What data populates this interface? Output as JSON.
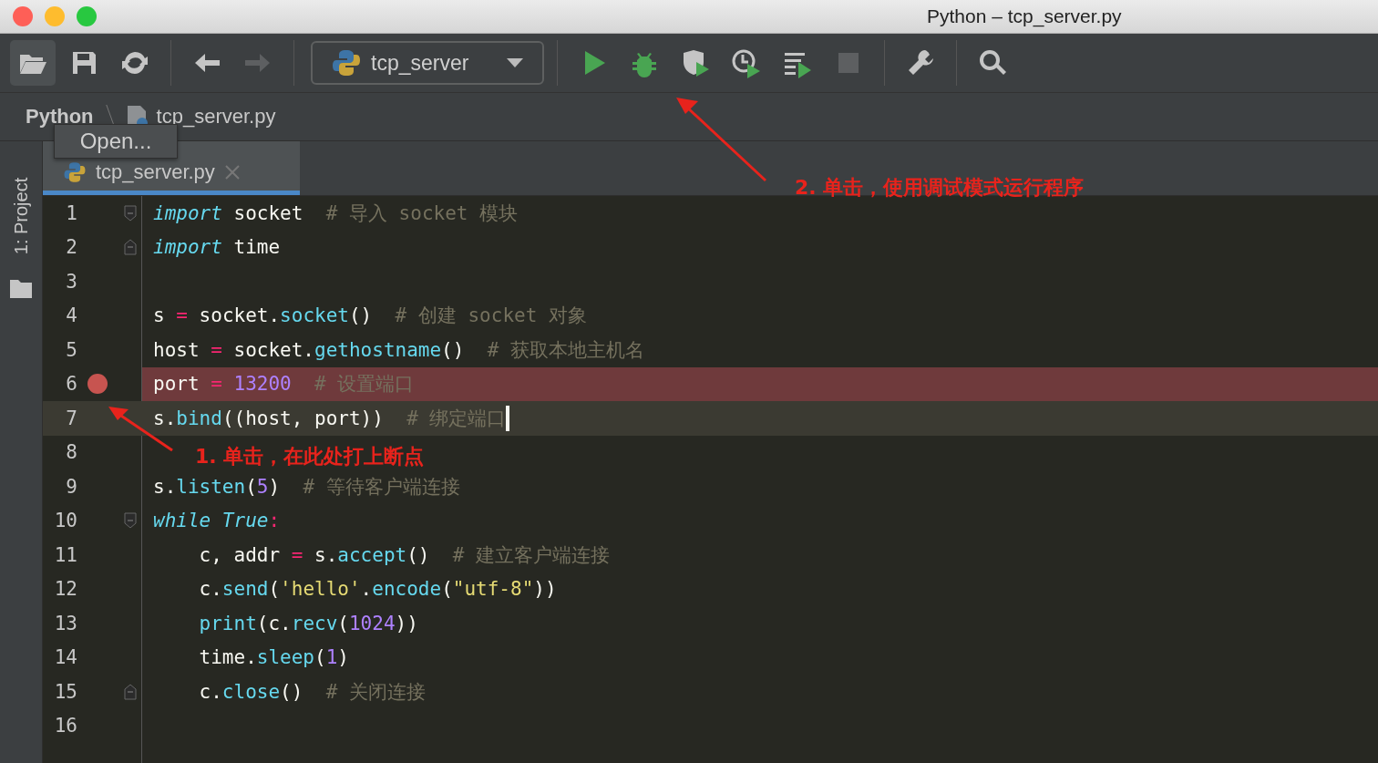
{
  "window": {
    "title": "Python – tcp_server.py"
  },
  "toolbar": {
    "buttons": [
      {
        "selected": true,
        "disabled": false
      },
      {
        "selected": false,
        "disabled": false
      },
      {
        "selected": false,
        "disabled": false
      },
      {
        "selected": false,
        "disabled": false
      },
      {
        "selected": false,
        "disabled": true
      },
      {
        "selected": false,
        "disabled": false
      },
      {
        "selected": false,
        "disabled": false
      },
      {
        "selected": false,
        "disabled": false
      },
      {
        "selected": false,
        "disabled": false
      },
      {
        "selected": false,
        "disabled": false
      },
      {
        "selected": false,
        "disabled": true
      },
      {
        "selected": false,
        "disabled": false
      },
      {
        "selected": false,
        "disabled": false
      }
    ],
    "run_config": {
      "label": "tcp_server"
    }
  },
  "breadcrumb": [
    {
      "label": "Python"
    },
    {
      "label": "tcp_server.py"
    }
  ],
  "tooltip": {
    "text": "Open..."
  },
  "side_panel": {
    "label": "1: Project"
  },
  "tabs": [
    {
      "label": "tcp_server.py",
      "selected": true
    }
  ],
  "editor": {
    "lines": [
      {
        "number": "1",
        "kind": "fold_start",
        "breakpoint": false,
        "current": false,
        "tokens": [
          {
            "kind": "kw",
            "text": "import"
          },
          {
            "kind": "plain",
            "text": " socket"
          },
          {
            "kind": "cmt",
            "text": "  # 导入 socket 模块"
          }
        ]
      },
      {
        "number": "2",
        "kind": "fold_end",
        "breakpoint": false,
        "current": false,
        "tokens": [
          {
            "kind": "kw",
            "text": "import"
          },
          {
            "kind": "plain",
            "text": " time"
          }
        ]
      },
      {
        "number": "3",
        "kind": "plain",
        "breakpoint": false,
        "current": false
      },
      {
        "number": "4",
        "kind": "plain",
        "breakpoint": false,
        "current": false,
        "tokens": [
          {
            "kind": "plain",
            "text": "s"
          },
          {
            "kind": "op",
            "text": " = "
          },
          {
            "kind": "plain",
            "text": "socket."
          },
          {
            "kind": "fn",
            "text": "socket"
          },
          {
            "kind": "plain",
            "text": "()"
          },
          {
            "kind": "cmt",
            "text": "  # 创建 socket 对象"
          }
        ]
      },
      {
        "number": "5",
        "kind": "plain",
        "breakpoint": false,
        "current": false,
        "tokens": [
          {
            "kind": "plain",
            "text": "host"
          },
          {
            "kind": "op",
            "text": " = "
          },
          {
            "kind": "plain",
            "text": "socket."
          },
          {
            "kind": "fn",
            "text": "gethostname"
          },
          {
            "kind": "plain",
            "text": "()"
          },
          {
            "kind": "cmt",
            "text": "  # 获取本地主机名"
          }
        ]
      },
      {
        "number": "6",
        "kind": "plain",
        "breakpoint": true,
        "current": false,
        "tokens": [
          {
            "kind": "plain",
            "text": "port"
          },
          {
            "kind": "op",
            "text": " = "
          },
          {
            "kind": "num",
            "text": "13200"
          },
          {
            "kind": "cmt",
            "text": "  # 设置端口"
          }
        ]
      },
      {
        "number": "7",
        "kind": "plain",
        "breakpoint": false,
        "current": true,
        "tokens": [
          {
            "kind": "plain",
            "text": "s."
          },
          {
            "kind": "fn",
            "text": "bind"
          },
          {
            "kind": "plain",
            "text": "((host, port))"
          },
          {
            "kind": "cmt",
            "text": "  # 绑定端口"
          }
        ]
      },
      {
        "number": "8",
        "kind": "plain",
        "breakpoint": false,
        "current": false
      },
      {
        "number": "9",
        "kind": "plain",
        "breakpoint": false,
        "current": false,
        "tokens": [
          {
            "kind": "plain",
            "text": "s."
          },
          {
            "kind": "fn",
            "text": "listen"
          },
          {
            "kind": "plain",
            "text": "("
          },
          {
            "kind": "num",
            "text": "5"
          },
          {
            "kind": "plain",
            "text": ")"
          },
          {
            "kind": "cmt",
            "text": "  # 等待客户端连接"
          }
        ]
      },
      {
        "number": "10",
        "kind": "fold_start",
        "breakpoint": false,
        "current": false,
        "tokens": [
          {
            "kind": "kw",
            "text": "while"
          },
          {
            "kind": "kw",
            "text": " True"
          },
          {
            "kind": "op",
            "text": ":"
          }
        ]
      },
      {
        "number": "11",
        "kind": "plain",
        "breakpoint": false,
        "current": false,
        "tokens": [
          {
            "kind": "plain",
            "text": "    c, addr"
          },
          {
            "kind": "op",
            "text": " = "
          },
          {
            "kind": "plain",
            "text": "s."
          },
          {
            "kind": "fn",
            "text": "accept"
          },
          {
            "kind": "plain",
            "text": "()"
          },
          {
            "kind": "cmt",
            "text": "  # 建立客户端连接"
          }
        ]
      },
      {
        "number": "12",
        "kind": "plain",
        "breakpoint": false,
        "current": false,
        "tokens": [
          {
            "kind": "plain",
            "text": "    c."
          },
          {
            "kind": "fn",
            "text": "send"
          },
          {
            "kind": "plain",
            "text": "("
          },
          {
            "kind": "str",
            "text": "'hello'"
          },
          {
            "kind": "plain",
            "text": "."
          },
          {
            "kind": "fn",
            "text": "encode"
          },
          {
            "kind": "plain",
            "text": "("
          },
          {
            "kind": "str",
            "text": "\"utf-8\""
          },
          {
            "kind": "plain",
            "text": "))"
          }
        ]
      },
      {
        "number": "13",
        "kind": "plain",
        "breakpoint": false,
        "current": false,
        "tokens": [
          {
            "kind": "fn",
            "text": "    print"
          },
          {
            "kind": "plain",
            "text": "(c."
          },
          {
            "kind": "fn",
            "text": "recv"
          },
          {
            "kind": "plain",
            "text": "("
          },
          {
            "kind": "num",
            "text": "1024"
          },
          {
            "kind": "plain",
            "text": "))"
          }
        ]
      },
      {
        "number": "14",
        "kind": "plain",
        "breakpoint": false,
        "current": false,
        "tokens": [
          {
            "kind": "plain",
            "text": "    time."
          },
          {
            "kind": "fn",
            "text": "sleep"
          },
          {
            "kind": "plain",
            "text": "("
          },
          {
            "kind": "num",
            "text": "1"
          },
          {
            "kind": "plain",
            "text": ")"
          }
        ]
      },
      {
        "number": "15",
        "kind": "fold_end",
        "breakpoint": false,
        "current": false,
        "tokens": [
          {
            "kind": "plain",
            "text": "    c."
          },
          {
            "kind": "fn",
            "text": "close"
          },
          {
            "kind": "plain",
            "text": "()"
          },
          {
            "kind": "cmt",
            "text": "  # 关闭连接"
          }
        ]
      },
      {
        "number": "16",
        "kind": "plain",
        "breakpoint": false,
        "current": false
      }
    ]
  },
  "annotations": [
    {
      "text": "1. 单击，在此处打上断点"
    },
    {
      "text": "2. 单击，使用调试模式运行程序"
    }
  ]
}
